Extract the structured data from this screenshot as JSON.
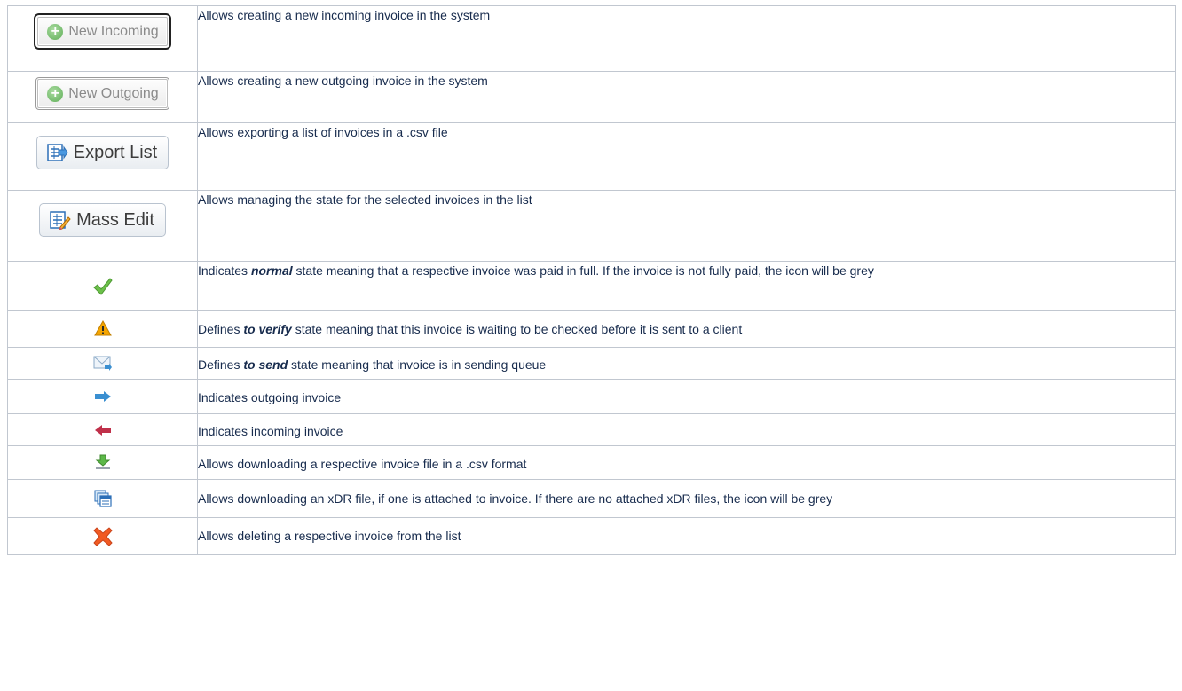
{
  "rows": [
    {
      "button": "New Incoming",
      "icon": "plus-circle-icon",
      "desc": "Allows creating a new incoming invoice in the system"
    },
    {
      "button": "New Outgoing",
      "icon": "plus-circle-icon",
      "desc": "Allows creating a new outgoing invoice in the system"
    },
    {
      "button": "Export List",
      "icon": "export-list-icon",
      "desc": "Allows exporting a list of invoices in a .csv file"
    },
    {
      "button": "Mass Edit",
      "icon": "mass-edit-icon",
      "desc": "Allows managing the state for the selected invoices in the list"
    },
    {
      "icon": "checkmark-icon",
      "desc_pre": "Indicates ",
      "desc_em": "normal",
      "desc_post": " state meaning that a respective invoice was paid in full. If the invoice is not fully paid, the icon will be grey"
    },
    {
      "icon": "warning-icon",
      "desc_pre": "Defines ",
      "desc_em": "to verify",
      "desc_post": " state meaning that this invoice is waiting to be checked before it is sent to a client"
    },
    {
      "icon": "envelope-icon",
      "desc_pre": "Defines ",
      "desc_em": "to send",
      "desc_post": " state meaning that invoice is in sending queue"
    },
    {
      "icon": "arrow-right-icon",
      "desc": "Indicates outgoing invoice"
    },
    {
      "icon": "arrow-left-icon",
      "desc": "Indicates incoming invoice"
    },
    {
      "icon": "download-icon",
      "desc": "Allows downloading a respective invoice file in a .csv format"
    },
    {
      "icon": "xdr-files-icon",
      "desc": "Allows downloading an xDR file, if one is attached to invoice. If there are no attached xDR files, the icon will be grey"
    },
    {
      "icon": "delete-x-icon",
      "desc": "Allows deleting a respective invoice from the list"
    }
  ],
  "colors": {
    "border": "#c1c7d0",
    "text": "#172b4d",
    "check": "#6cc04a",
    "warning": "#f5a500",
    "arrow_right": "#3a8fd1",
    "arrow_left": "#c0304a",
    "delete": "#f15a22"
  }
}
